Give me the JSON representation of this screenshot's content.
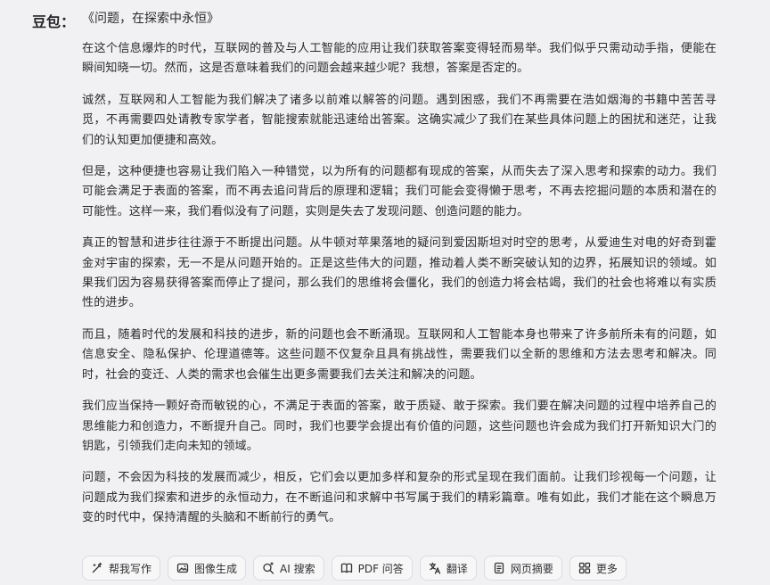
{
  "speaker": "豆包：",
  "essay_title": "《问题，在探索中永恒》",
  "paragraphs": [
    "在这个信息爆炸的时代，互联网的普及与人工智能的应用让我们获取答案变得轻而易举。我们似乎只需动动手指，便能在瞬间知晓一切。然而，这是否意味着我们的问题会越来越少呢？我想，答案是否定的。",
    "诚然，互联网和人工智能为我们解决了诸多以前难以解答的问题。遇到困惑，我们不再需要在浩如烟海的书籍中苦苦寻觅，不再需要四处请教专家学者，智能搜索就能迅速给出答案。这确实减少了我们在某些具体问题上的困扰和迷茫，让我们的认知更加便捷和高效。",
    "但是，这种便捷也容易让我们陷入一种错觉，以为所有的问题都有现成的答案，从而失去了深入思考和探索的动力。我们可能会满足于表面的答案，而不再去追问背后的原理和逻辑；我们可能会变得懒于思考，不再去挖掘问题的本质和潜在的可能性。这样一来，我们看似没有了问题，实则是失去了发现问题、创造问题的能力。",
    "真正的智慧和进步往往源于不断提出问题。从牛顿对苹果落地的疑问到爱因斯坦对时空的思考，从爱迪生对电的好奇到霍金对宇宙的探索，无一不是从问题开始的。正是这些伟大的问题，推动着人类不断突破认知的边界，拓展知识的领域。如果我们因为容易获得答案而停止了提问，那么我们的思维将会僵化，我们的创造力将会枯竭，我们的社会也将难以有实质性的进步。",
    "而且，随着时代的发展和科技的进步，新的问题也会不断涌现。互联网和人工智能本身也带来了许多前所未有的问题，如信息安全、隐私保护、伦理道德等。这些问题不仅复杂且具有挑战性，需要我们以全新的思维和方法去思考和解决。同时，社会的变迁、人类的需求也会催生出更多需要我们去关注和解决的问题。",
    "我们应当保持一颗好奇而敏锐的心，不满足于表面的答案，敢于质疑、敢于探索。我们要在解决问题的过程中培养自己的思维能力和创造力，不断提升自己。同时，我们也要学会提出有价值的问题，这些问题也许会成为我们打开新知识大门的钥匙，引领我们走向未知的领域。",
    "问题，不会因为科技的发展而减少，相反，它们会以更加多样和复杂的形式呈现在我们面前。让我们珍视每一个问题，让问题成为我们探索和进步的永恒动力，在不断追问和求解中书写属于我们的精彩篇章。唯有如此，我们才能在这个瞬息万变的时代中，保持清醒的头脑和不断前行的勇气。"
  ],
  "toolbar": {
    "buttons": [
      {
        "label": "帮我写作",
        "icon": "pen-sparkle-icon"
      },
      {
        "label": "图像生成",
        "icon": "image-icon"
      },
      {
        "label": "AI 搜索",
        "icon": "search-sparkle-icon"
      },
      {
        "label": "PDF 问答",
        "icon": "book-icon"
      },
      {
        "label": "翻译",
        "icon": "translate-icon"
      },
      {
        "label": "网页摘要",
        "icon": "document-icon"
      },
      {
        "label": "更多",
        "icon": "grid-icon"
      }
    ]
  }
}
